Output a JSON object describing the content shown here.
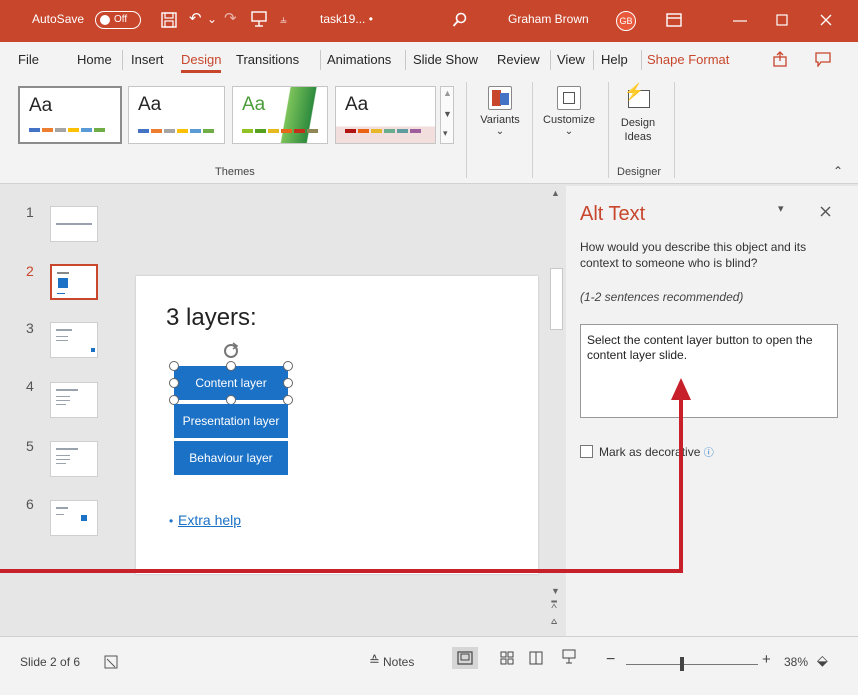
{
  "titlebar": {
    "autosave_label": "AutoSave",
    "toggle_state": "Off",
    "filename": "task19... •",
    "user": "Graham Brown",
    "avatar": "GB"
  },
  "menu": {
    "file": "File",
    "home": "Home",
    "insert": "Insert",
    "design": "Design",
    "transitions": "Transitions",
    "animations": "Animations",
    "slideshow": "Slide Show",
    "review": "Review",
    "view": "View",
    "help": "Help",
    "shape_format": "Shape Format"
  },
  "ribbon": {
    "themes": [
      "Aa",
      "Aa",
      "Aa",
      "Aa"
    ],
    "themes_label": "Themes",
    "variants": "Variants",
    "customize": "Customize",
    "design_ideas": "Design Ideas",
    "designer_label": "Designer"
  },
  "thumbnails": [
    "1",
    "2",
    "3",
    "4",
    "5",
    "6"
  ],
  "slide": {
    "title": "3 layers:",
    "buttons": [
      "Content layer",
      "Presentation layer",
      "Behaviour layer"
    ],
    "bullet": "•",
    "link": "Extra help"
  },
  "alt_text": {
    "title": "Alt Text",
    "description": "How would you describe this object and its context to someone who is blind?",
    "recommendation": "(1-2 sentences recommended)",
    "value": "Select the content layer button to open the content layer slide.",
    "decorative_label": "Mark as decorative"
  },
  "status": {
    "slide_count": "Slide 2 of 6",
    "notes": "Notes",
    "zoom": "38%"
  },
  "colors": {
    "accent": "#c8462c",
    "button_blue": "#1b71c5",
    "arrow_red": "#c8202a"
  }
}
